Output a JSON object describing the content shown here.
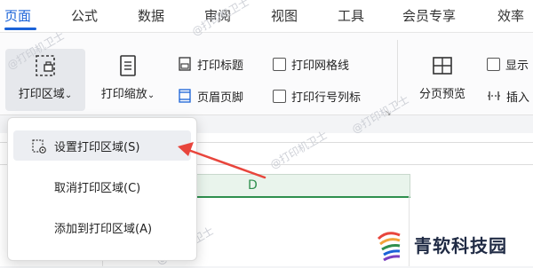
{
  "menubar": {
    "tabs": [
      {
        "label": "页面",
        "active": true
      },
      {
        "label": "公式"
      },
      {
        "label": "数据"
      },
      {
        "label": "审阅"
      },
      {
        "label": "视图"
      },
      {
        "label": "工具"
      },
      {
        "label": "会员专享"
      },
      {
        "label": "效率"
      }
    ]
  },
  "ribbon": {
    "print_area": {
      "label": "打印区域",
      "arrow": "⌄"
    },
    "print_scale": {
      "label": "打印缩放",
      "arrow": "⌄"
    },
    "print_titles": {
      "label": "打印标题"
    },
    "header_footer": {
      "label": "页眉页脚"
    },
    "print_gridlines": {
      "label": "打印网格线",
      "checked": false
    },
    "print_row_col_labels": {
      "label": "打印行号列标",
      "checked": false
    },
    "page_break_preview": {
      "label": "分页预览"
    },
    "show": {
      "label": "显示",
      "checked": false
    },
    "insert": {
      "label": "插入"
    }
  },
  "dropdown": {
    "items": [
      {
        "label": "设置打印区域(S)",
        "highlighted": true
      },
      {
        "label": "取消打印区域(C)"
      },
      {
        "label": "添加到打印区域(A)"
      }
    ]
  },
  "sheet": {
    "column_label": "D"
  },
  "watermark": {
    "text": "@打印机卫士"
  },
  "logo": {
    "text": "青软科技园"
  },
  "colors": {
    "accent": "#1a62d8",
    "arrow": "#e8453c",
    "column_green": "#2f8f4e"
  }
}
